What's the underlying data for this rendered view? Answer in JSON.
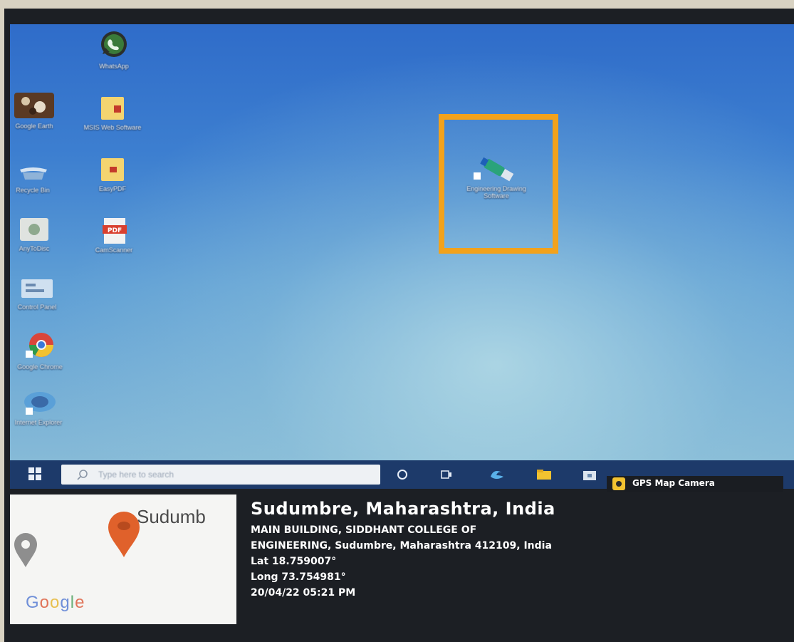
{
  "desktop": {
    "icons": [
      {
        "label": "WhatsApp",
        "icon": "whatsapp-icon"
      },
      {
        "label": "Google Earth",
        "icon": "image-icon"
      },
      {
        "label": "MSIS Web Software",
        "icon": "folder-icon"
      },
      {
        "label": "Recycle Bin",
        "icon": "recycle-bin-icon"
      },
      {
        "label": "EasyPDF",
        "icon": "folder-icon"
      },
      {
        "label": "AnyToDisc",
        "icon": "disc-app-icon"
      },
      {
        "label": "CamScanner",
        "icon": "pdf-icon"
      },
      {
        "label": "Control Panel",
        "icon": "control-panel-icon"
      },
      {
        "label": "Google Chrome",
        "icon": "chrome-icon"
      },
      {
        "label": "Internet Explorer",
        "icon": "ie-icon"
      }
    ],
    "highlighted_icon": {
      "label": "Engineering Drawing Software",
      "icon": "usb-drive-icon"
    }
  },
  "taskbar": {
    "search_placeholder": "Type here to search"
  },
  "overlay": {
    "app_tag": "GPS Map Camera",
    "map_place_text": "Sudumb",
    "map_brand": "Google",
    "title": "Sudumbre, Maharashtra, India",
    "address_line1": "MAIN BUILDING, SIDDHANT COLLEGE OF",
    "address_line2": "ENGINEERING, Sudumbre, Maharashtra 412109, India",
    "lat": "Lat 18.759007°",
    "long": "Long 73.754981°",
    "timestamp": "20/04/22 05:21 PM"
  },
  "colors": {
    "highlight_border": "#f2a21c",
    "taskbar": "#1d3a6a",
    "map_pin": "#e0612b"
  }
}
